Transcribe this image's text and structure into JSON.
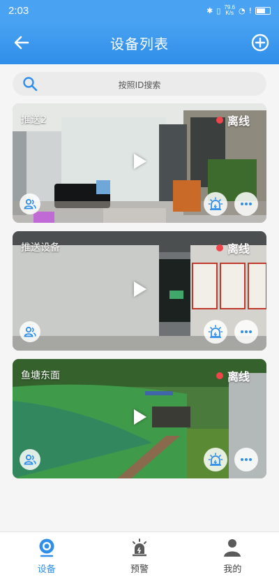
{
  "status_bar": {
    "time": "2:03",
    "net_speed_value": "79.6",
    "net_speed_unit": "K/s"
  },
  "header": {
    "title": "设备列表"
  },
  "search": {
    "placeholder": "按照ID搜索"
  },
  "devices": [
    {
      "name": "推送2",
      "status": "离线"
    },
    {
      "name": "推送设备",
      "status": "离线"
    },
    {
      "name": "鱼塘东面",
      "status": "离线"
    }
  ],
  "tabs": [
    {
      "label": "设备"
    },
    {
      "label": "预警"
    },
    {
      "label": "我的"
    }
  ],
  "colors": {
    "accent": "#2f8ee9",
    "header": "#4aa3f2",
    "offline_dot": "#f0454a"
  }
}
